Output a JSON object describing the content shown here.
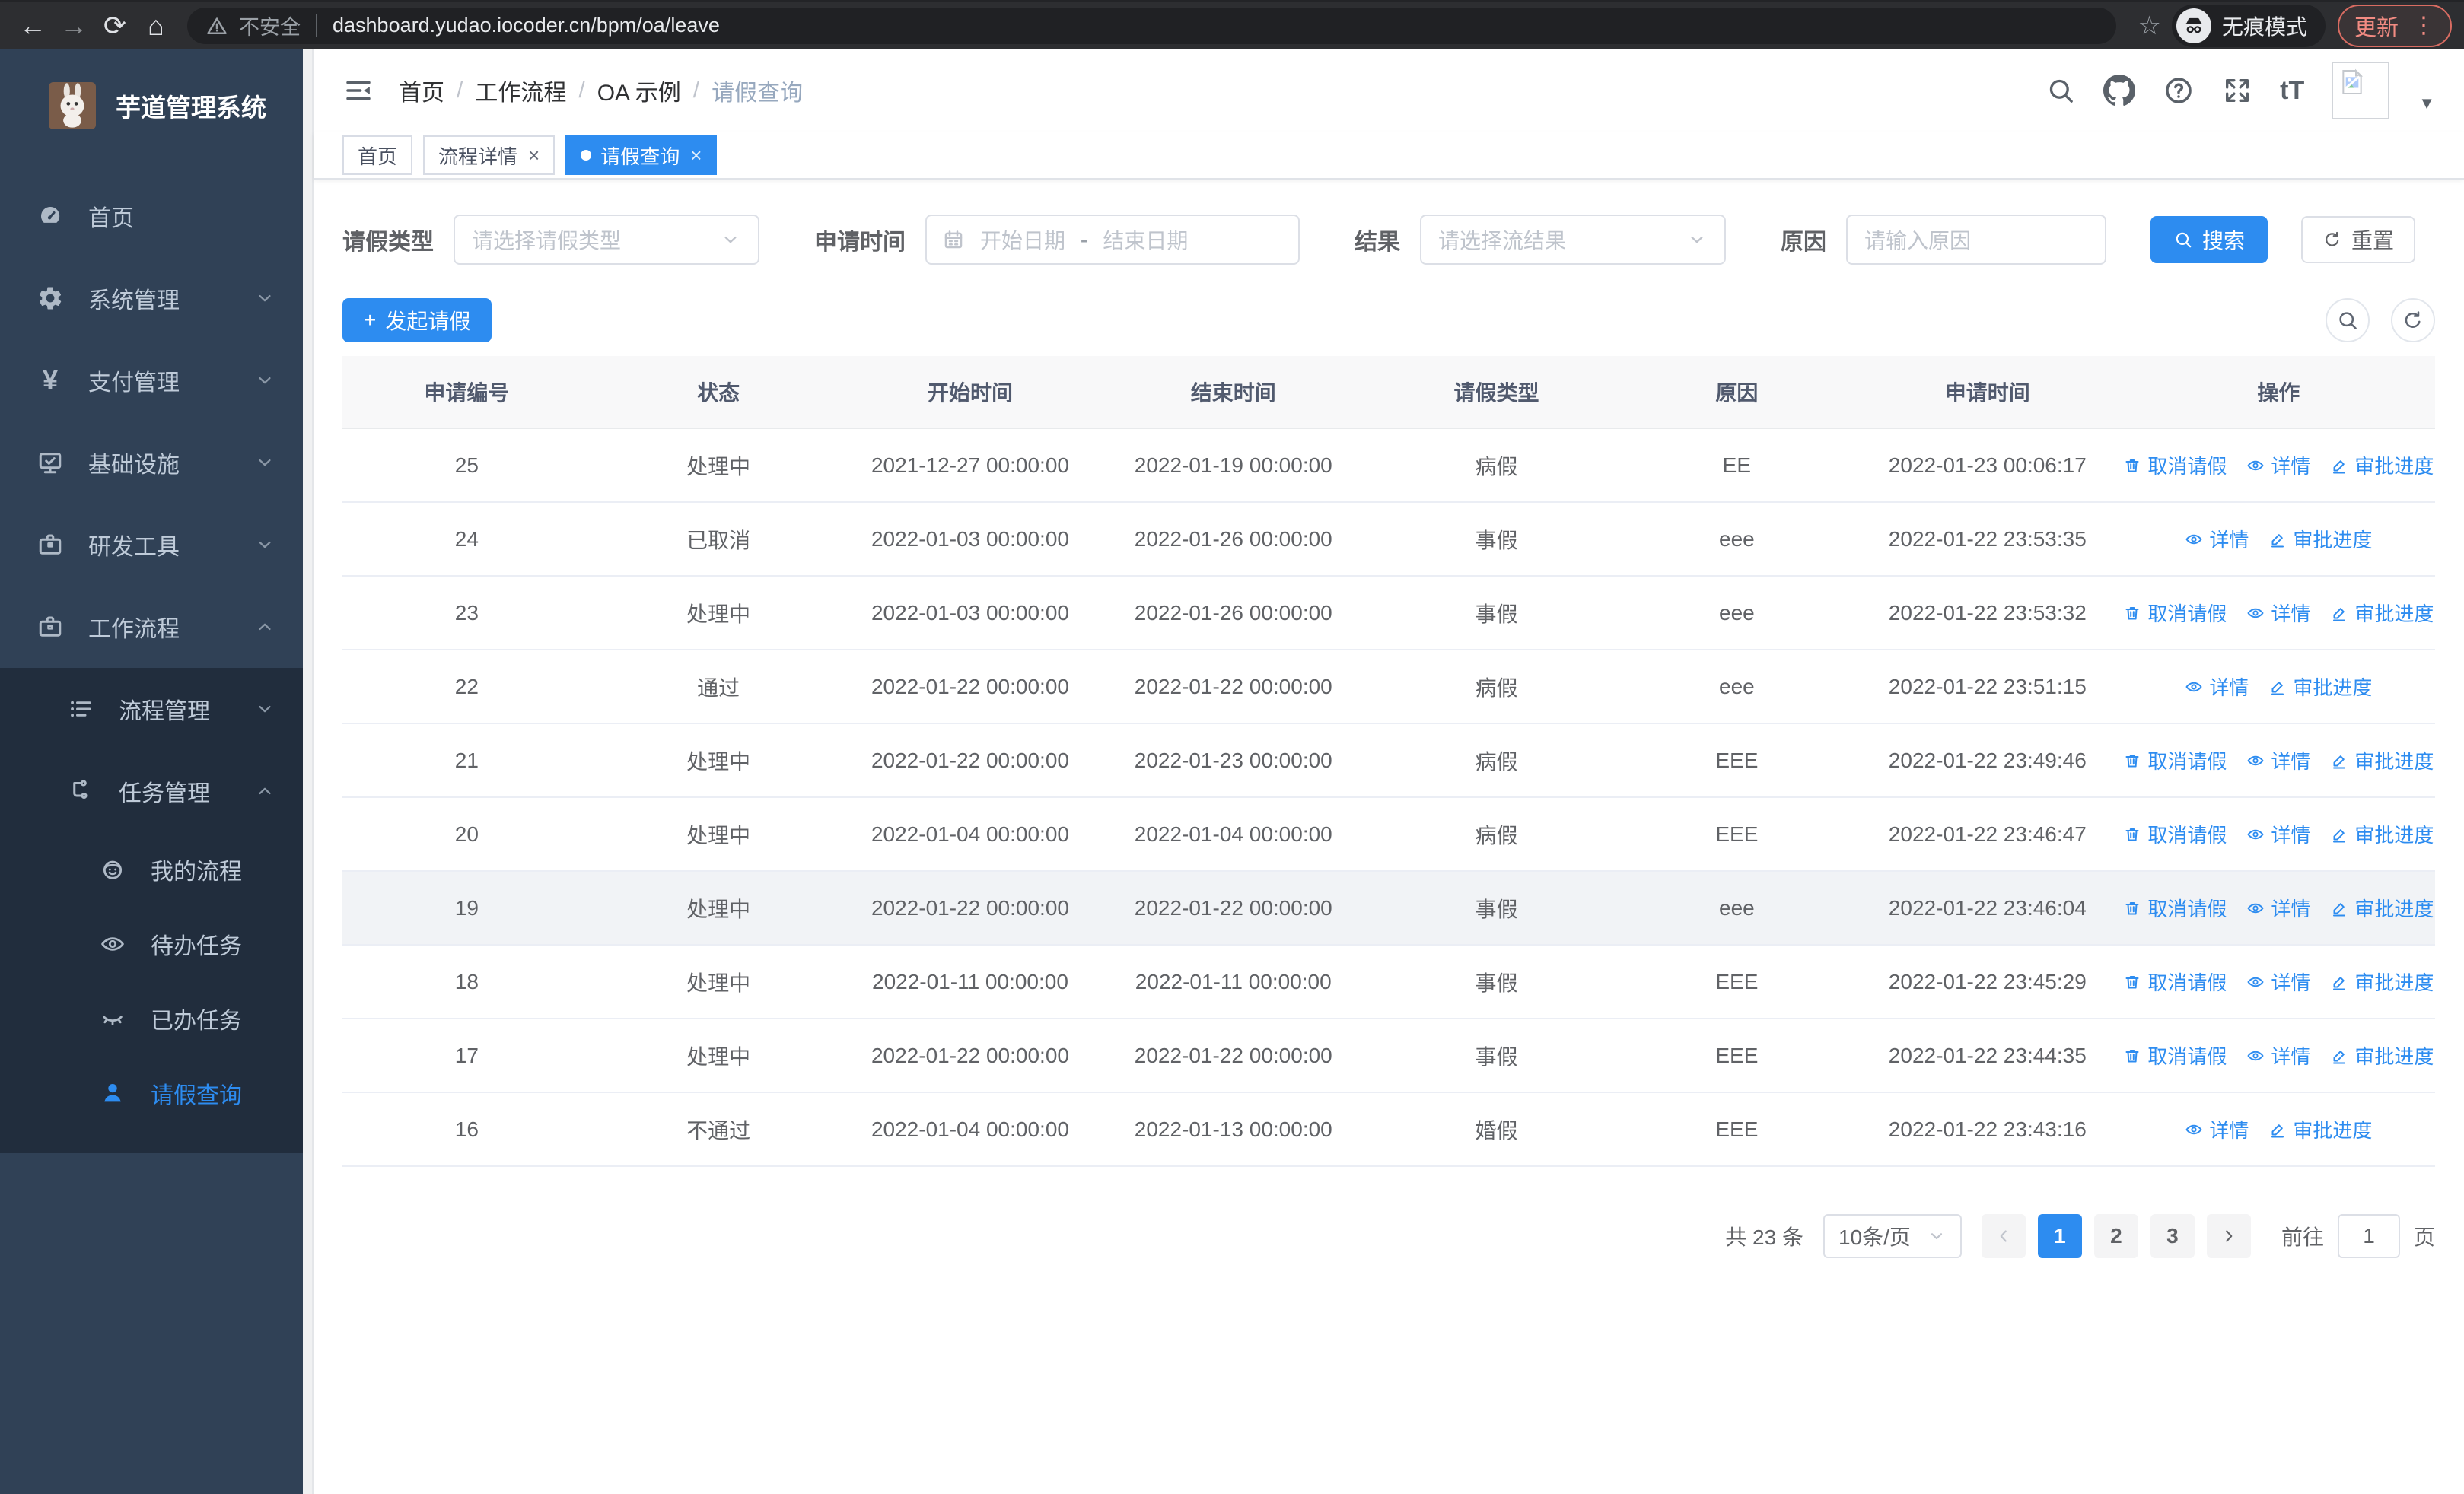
{
  "colors": {
    "accent": "#2d8cf0",
    "sidebar_bg": "#304156",
    "submenu_bg": "#212d3d"
  },
  "browser": {
    "security_label": "不安全",
    "url": "dashboard.yudao.iocoder.cn/bpm/oa/leave",
    "incognito_label": "无痕模式",
    "update_label": "更新",
    "menu_dots": "⋮",
    "back": "←",
    "forward": "→",
    "reload": "⟳",
    "home": "⌂",
    "star": "☆"
  },
  "sidebar": {
    "title": "芋道管理系统",
    "items": [
      {
        "label": "首页",
        "icon": "dashboard-icon",
        "level": 1,
        "chevron": "",
        "submenu": false,
        "active": false
      },
      {
        "label": "系统管理",
        "icon": "gear-icon",
        "level": 1,
        "chevron": "down",
        "submenu": false,
        "active": false
      },
      {
        "label": "支付管理",
        "icon": "yen-icon",
        "level": 1,
        "chevron": "down",
        "submenu": false,
        "active": false
      },
      {
        "label": "基础设施",
        "icon": "monitor-icon",
        "level": 1,
        "chevron": "down",
        "submenu": false,
        "active": false
      },
      {
        "label": "研发工具",
        "icon": "briefcase-icon",
        "level": 1,
        "chevron": "down",
        "submenu": false,
        "active": false
      },
      {
        "label": "工作流程",
        "icon": "briefcase-icon",
        "level": 1,
        "chevron": "up",
        "submenu": false,
        "active": false
      },
      {
        "label": "流程管理",
        "icon": "list-icon",
        "level": 2,
        "chevron": "down",
        "submenu": true,
        "active": false
      },
      {
        "label": "任务管理",
        "icon": "flow-icon",
        "level": 2,
        "chevron": "up",
        "submenu": true,
        "active": false
      },
      {
        "label": "我的流程",
        "icon": "robot-icon",
        "level": 3,
        "chevron": "",
        "submenu": true,
        "active": false
      },
      {
        "label": "待办任务",
        "icon": "eye-open-icon",
        "level": 3,
        "chevron": "",
        "submenu": true,
        "active": false
      },
      {
        "label": "已办任务",
        "icon": "eye-closed-icon",
        "level": 3,
        "chevron": "",
        "submenu": true,
        "active": false
      },
      {
        "label": "请假查询",
        "icon": "user-icon",
        "level": 3,
        "chevron": "",
        "submenu": true,
        "active": true
      }
    ]
  },
  "header": {
    "breadcrumb": [
      "首页",
      "工作流程",
      "OA 示例",
      "请假查询"
    ],
    "separator": "/",
    "font_icon_label": "tT",
    "caret": "▼"
  },
  "tabs": [
    {
      "label": "首页",
      "closable": false,
      "active": false
    },
    {
      "label": "流程详情",
      "closable": true,
      "active": false
    },
    {
      "label": "请假查询",
      "closable": true,
      "active": true
    }
  ],
  "filters": {
    "leave_type_label": "请假类型",
    "leave_type_placeholder": "请选择请假类型",
    "apply_time_label": "申请时间",
    "start_date_placeholder": "开始日期",
    "range_separator": "-",
    "end_date_placeholder": "结束日期",
    "result_label": "结果",
    "result_placeholder": "请选择流结果",
    "reason_label": "原因",
    "reason_placeholder": "请输入原因",
    "search_label": "搜索",
    "reset_label": "重置"
  },
  "toolbar": {
    "create_label": "发起请假",
    "plus": "+"
  },
  "table": {
    "columns": [
      "申请编号",
      "状态",
      "开始时间",
      "结束时间",
      "请假类型",
      "原因",
      "申请时间",
      "操作"
    ],
    "action_labels": {
      "cancel": "取消请假",
      "detail": "详情",
      "progress": "审批进度"
    },
    "rows": [
      {
        "id": "25",
        "status": "处理中",
        "start": "2021-12-27 00:00:00",
        "end": "2022-01-19 00:00:00",
        "type": "病假",
        "reason": "EE",
        "apply_time": "2022-01-23 00:06:17",
        "actions": [
          "cancel",
          "detail",
          "progress"
        ],
        "highlight": false
      },
      {
        "id": "24",
        "status": "已取消",
        "start": "2022-01-03 00:00:00",
        "end": "2022-01-26 00:00:00",
        "type": "事假",
        "reason": "eee",
        "apply_time": "2022-01-22 23:53:35",
        "actions": [
          "detail",
          "progress"
        ],
        "highlight": false
      },
      {
        "id": "23",
        "status": "处理中",
        "start": "2022-01-03 00:00:00",
        "end": "2022-01-26 00:00:00",
        "type": "事假",
        "reason": "eee",
        "apply_time": "2022-01-22 23:53:32",
        "actions": [
          "cancel",
          "detail",
          "progress"
        ],
        "highlight": false
      },
      {
        "id": "22",
        "status": "通过",
        "start": "2022-01-22 00:00:00",
        "end": "2022-01-22 00:00:00",
        "type": "病假",
        "reason": "eee",
        "apply_time": "2022-01-22 23:51:15",
        "actions": [
          "detail",
          "progress"
        ],
        "highlight": false
      },
      {
        "id": "21",
        "status": "处理中",
        "start": "2022-01-22 00:00:00",
        "end": "2022-01-23 00:00:00",
        "type": "病假",
        "reason": "EEE",
        "apply_time": "2022-01-22 23:49:46",
        "actions": [
          "cancel",
          "detail",
          "progress"
        ],
        "highlight": false
      },
      {
        "id": "20",
        "status": "处理中",
        "start": "2022-01-04 00:00:00",
        "end": "2022-01-04 00:00:00",
        "type": "病假",
        "reason": "EEE",
        "apply_time": "2022-01-22 23:46:47",
        "actions": [
          "cancel",
          "detail",
          "progress"
        ],
        "highlight": false
      },
      {
        "id": "19",
        "status": "处理中",
        "start": "2022-01-22 00:00:00",
        "end": "2022-01-22 00:00:00",
        "type": "事假",
        "reason": "eee",
        "apply_time": "2022-01-22 23:46:04",
        "actions": [
          "cancel",
          "detail",
          "progress"
        ],
        "highlight": true
      },
      {
        "id": "18",
        "status": "处理中",
        "start": "2022-01-11 00:00:00",
        "end": "2022-01-11 00:00:00",
        "type": "事假",
        "reason": "EEE",
        "apply_time": "2022-01-22 23:45:29",
        "actions": [
          "cancel",
          "detail",
          "progress"
        ],
        "highlight": false
      },
      {
        "id": "17",
        "status": "处理中",
        "start": "2022-01-22 00:00:00",
        "end": "2022-01-22 00:00:00",
        "type": "事假",
        "reason": "EEE",
        "apply_time": "2022-01-22 23:44:35",
        "actions": [
          "cancel",
          "detail",
          "progress"
        ],
        "highlight": false
      },
      {
        "id": "16",
        "status": "不通过",
        "start": "2022-01-04 00:00:00",
        "end": "2022-01-13 00:00:00",
        "type": "婚假",
        "reason": "EEE",
        "apply_time": "2022-01-22 23:43:16",
        "actions": [
          "detail",
          "progress"
        ],
        "highlight": false
      }
    ]
  },
  "pagination": {
    "total_label": "共 23 条",
    "page_size": "10条/页",
    "pages": [
      "1",
      "2",
      "3"
    ],
    "active_page": "1",
    "goto_label": "前往",
    "goto_value": "1",
    "page_unit": "页"
  }
}
